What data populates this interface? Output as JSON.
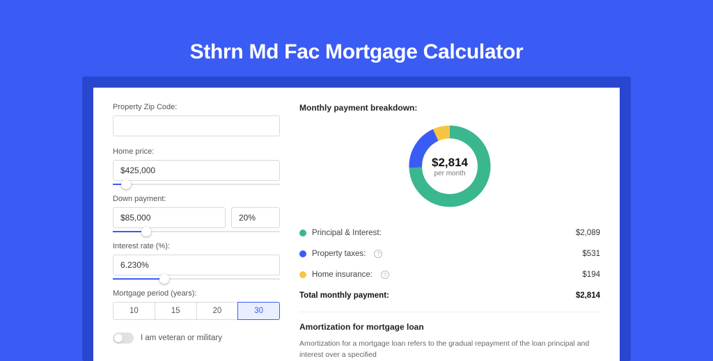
{
  "title": "Sthrn Md Fac Mortgage Calculator",
  "left": {
    "zip_label": "Property Zip Code:",
    "zip_value": "",
    "home_price_label": "Home price:",
    "home_price_value": "$425,000",
    "home_price_pct": 8,
    "down_label": "Down payment:",
    "down_value": "$85,000",
    "down_pct_value": "20%",
    "down_pct": 20,
    "rate_label": "Interest rate (%):",
    "rate_value": "6.230%",
    "rate_pct": 31,
    "period_label": "Mortgage period (years):",
    "periods": [
      "10",
      "15",
      "20",
      "30"
    ],
    "period_active": "30",
    "veteran_label": "I am veteran or military"
  },
  "right": {
    "breakdown_title": "Monthly payment breakdown:",
    "center_value": "$2,814",
    "center_sub": "per month",
    "rows": [
      {
        "key": "pi",
        "color": "#3bb78f",
        "label": "Principal & Interest:",
        "value": "$2,089",
        "num": 2089,
        "info": false
      },
      {
        "key": "tax",
        "color": "#3a5cf5",
        "label": "Property taxes:",
        "value": "$531",
        "num": 531,
        "info": true
      },
      {
        "key": "ins",
        "color": "#f5c542",
        "label": "Home insurance:",
        "value": "$194",
        "num": 194,
        "info": true
      }
    ],
    "total_label": "Total monthly payment:",
    "total_value": "$2,814",
    "amort_title": "Amortization for mortgage loan",
    "amort_text": "Amortization for a mortgage loan refers to the gradual repayment of the loan principal and interest over a specified"
  },
  "chart_data": {
    "type": "pie",
    "title": "Monthly payment breakdown",
    "series": [
      {
        "name": "Principal & Interest",
        "value": 2089,
        "color": "#3bb78f"
      },
      {
        "name": "Property taxes",
        "value": 531,
        "color": "#3a5cf5"
      },
      {
        "name": "Home insurance",
        "value": 194,
        "color": "#f5c542"
      }
    ],
    "total": 2814
  }
}
